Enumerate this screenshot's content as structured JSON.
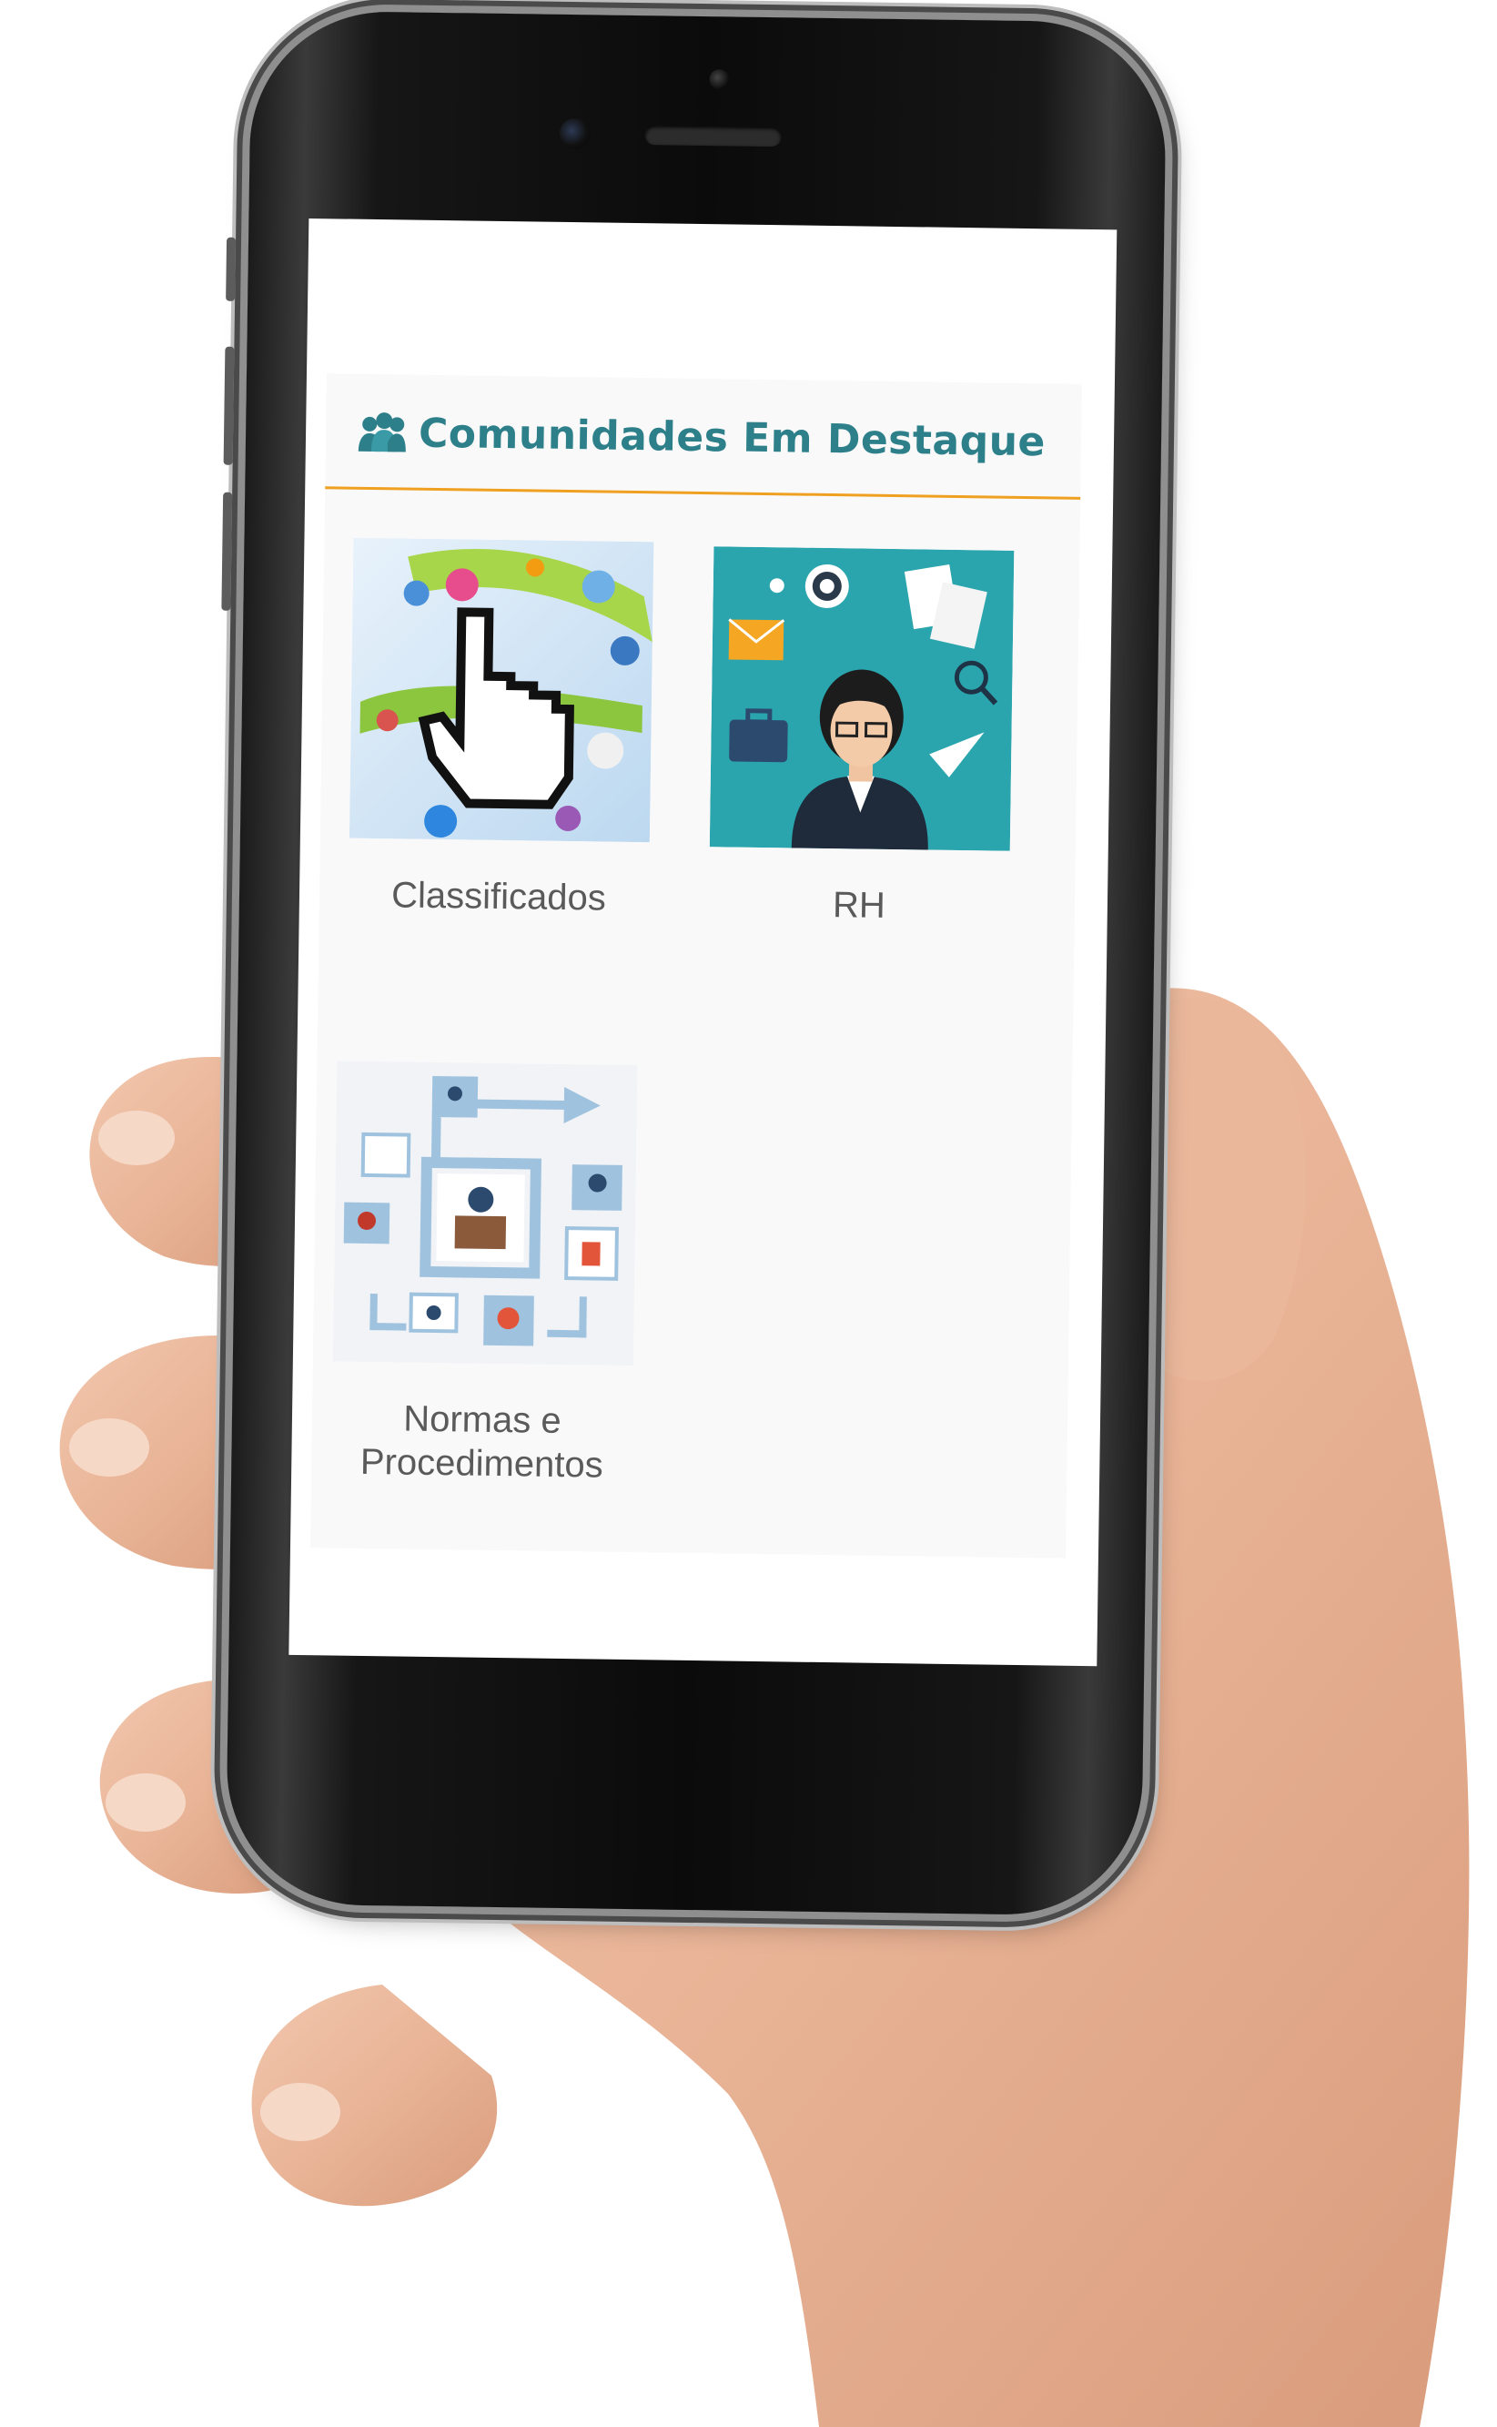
{
  "section": {
    "icon": "community-icon",
    "title": "Comunidades Em Destaque"
  },
  "communities": [
    {
      "label": "Classificados",
      "thumbnail": "classifieds-thumbnail"
    },
    {
      "label": "RH",
      "thumbnail": "hr-thumbnail"
    },
    {
      "label": "Normas e Procedimentos",
      "thumbnail": "norms-procedures-thumbnail"
    }
  ],
  "colors": {
    "title": "#2d7f8a",
    "divider": "#f0a020",
    "label": "#5a5a5a",
    "panel_background": "#f9f9fa",
    "hr_thumbnail_background": "#2aa5ad"
  }
}
